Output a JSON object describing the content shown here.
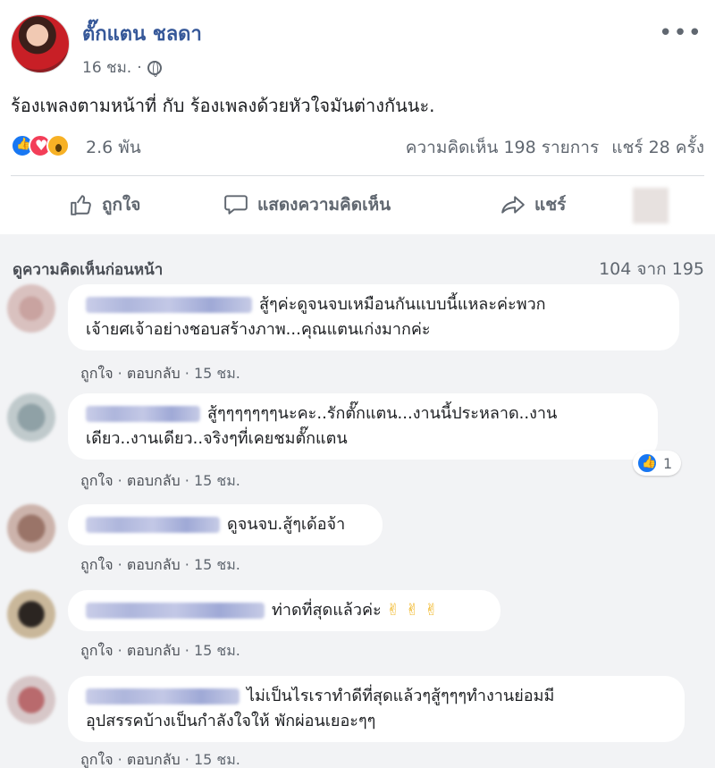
{
  "post": {
    "author": "ตั๊กแตน ชลดา",
    "time": "16 ชม.",
    "text": "ร้องเพลงตามหน้าที่ กับ ร้องเพลงด้วยหัวใจมันต่างกันนะ.",
    "reaction_count": "2.6 พัน",
    "comments_count": "ความคิดเห็น 198 รายการ",
    "shares_count": "แชร์ 28 ครั้ง"
  },
  "actions": {
    "like": "ถูกใจ",
    "comment": "แสดงความคิดเห็น",
    "share": "แชร์"
  },
  "comments_header": {
    "view_previous": "ดูความคิดเห็นก่อนหน้า",
    "count": "104 จาก 195"
  },
  "comment_actions": {
    "like": "ถูกใจ",
    "separator": "·",
    "reply": "ตอบกลับ"
  },
  "comments": [
    {
      "line1": "สู้ๆค่ะดูจนจบเหมือนกันแบบนี้แหละค่ะพวก",
      "line2": "เจ้ายศเจ้าอย่างชอบสร้างภาพ...คุณแตนเก่งมากค่ะ",
      "time": "15 ชม."
    },
    {
      "line1": "สู้ๆๆๆๆๆๆๆนะคะ..รักตั๊กแตน...งานนี้ประหลาด..งาน",
      "line2": "เดียว..งานเดียว..จริงๆที่เคยชมตั๊กแตน",
      "time": "15 ชม.",
      "reaction_count": "1"
    },
    {
      "line1": "ดูจนจบ.สู้ๆเด้อจ้า",
      "line2": "",
      "time": "15 ชม."
    },
    {
      "line1": "ท่าดที่สุดแล้วค่ะ",
      "emoji": "✌ ✌ ✌",
      "line2": "",
      "time": "15 ชม."
    },
    {
      "line1": "ไม่เป็นไรเราทำดีที่สุดแล้วๆสู้ๆๆๆทำงานย่อมมี",
      "line2": "อุปสรรคบ้างเป็นกำลังใจให้ พักผ่อนเยอะๆๆ",
      "time": "15 ชม."
    }
  ],
  "colors": {
    "author_blue": "#365899",
    "like_blue": "#1877f2",
    "love_red": "#f33e58",
    "wow_yellow": "#f7b125",
    "comments_bg": "#f2f3f5"
  }
}
